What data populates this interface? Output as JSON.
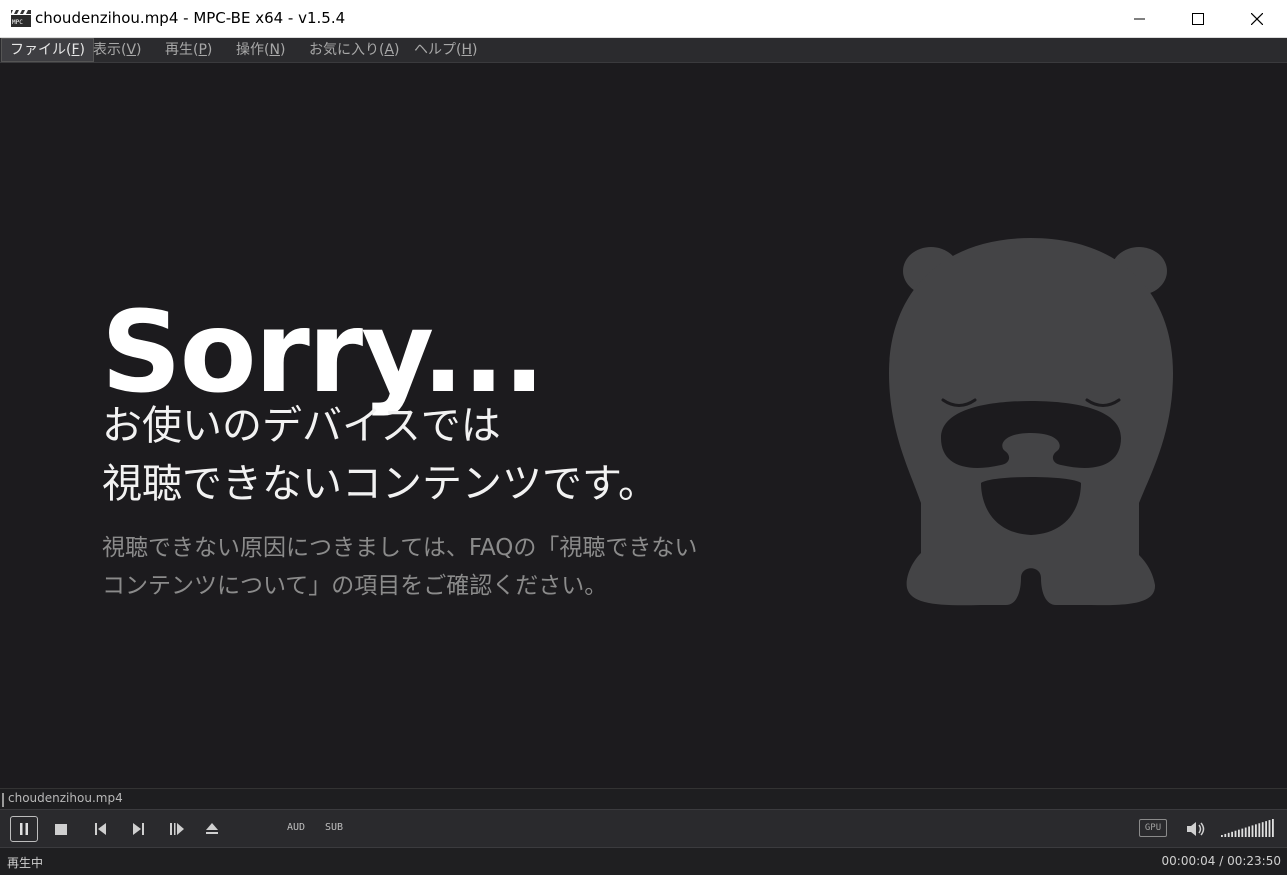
{
  "window": {
    "title": "choudenzihou.mp4 - MPC-BE x64 - v1.5.4",
    "app_icon": "mpc-be-clapper-icon"
  },
  "window_controls": {
    "minimize_icon": "minimize-icon",
    "maximize_icon": "maximize-icon",
    "close_icon": "close-icon"
  },
  "menu": {
    "items": [
      {
        "label": "ファイル(",
        "mnemonic": "F",
        "end": ")"
      },
      {
        "label": "表示(",
        "mnemonic": "V",
        "end": ")"
      },
      {
        "label": "再生(",
        "mnemonic": "P",
        "end": ")"
      },
      {
        "label": "操作(",
        "mnemonic": "N",
        "end": ")"
      },
      {
        "label": "お気に入り(",
        "mnemonic": "A",
        "end": ")"
      },
      {
        "label": "ヘルプ(",
        "mnemonic": "H",
        "end": ")"
      }
    ]
  },
  "video": {
    "sorry": "Sorry...",
    "headline_line1": "お使いのデバイスでは",
    "headline_line2": "視聴できないコンテンツです。",
    "sub_line1": "視聴できない原因につきましては、FAQの「視聴できない",
    "sub_line2": "コンテンツについて」の項目をご確認ください。",
    "mascot_icon": "sleeping-bear-mascot-icon"
  },
  "file_strip": {
    "filename": "choudenzihou.mp4"
  },
  "controls": {
    "pause_icon": "pause-icon",
    "stop_icon": "stop-icon",
    "prev_icon": "previous-icon",
    "next_icon": "next-icon",
    "frame_step_icon": "frame-step-icon",
    "eject_icon": "eject-icon",
    "aud_label": "AUD",
    "sub_label": "SUB",
    "gpu_label": "GPU",
    "volume_icon": "speaker-icon",
    "volume_level": 1.0
  },
  "status": {
    "state": "再生中",
    "time": "00:00:04 / 00:23:50"
  },
  "colors": {
    "video_bg": "#1c1b1e",
    "mascot": "#444446",
    "accent_text": "#ffffff"
  }
}
